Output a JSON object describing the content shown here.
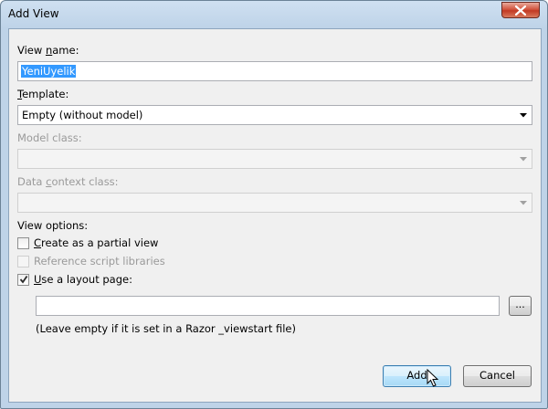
{
  "window": {
    "title": "Add View"
  },
  "view_name": {
    "label_pre": "View ",
    "label_key": "n",
    "label_post": "ame:",
    "value": "YeniUyelik"
  },
  "template": {
    "label_key": "T",
    "label_post": "emplate:",
    "value": "Empty (without model)"
  },
  "model_class": {
    "label": "Model class:",
    "value": ""
  },
  "data_context": {
    "label_pre": "Data ",
    "label_key": "c",
    "label_post": "ontext class:",
    "value": ""
  },
  "view_options": {
    "label": "View options:"
  },
  "partial": {
    "label_key": "C",
    "label_post": "reate as a partial view",
    "checked": false
  },
  "script_libs": {
    "label": "Reference script libraries",
    "checked": false,
    "enabled": false
  },
  "layout_page": {
    "label_key": "U",
    "label_post": "se a layout page:",
    "checked": true,
    "value": "",
    "browse_label": "...",
    "hint": "(Leave empty if it is set in a Razor _viewstart file)"
  },
  "buttons": {
    "add": "Add",
    "cancel": "Cancel"
  }
}
